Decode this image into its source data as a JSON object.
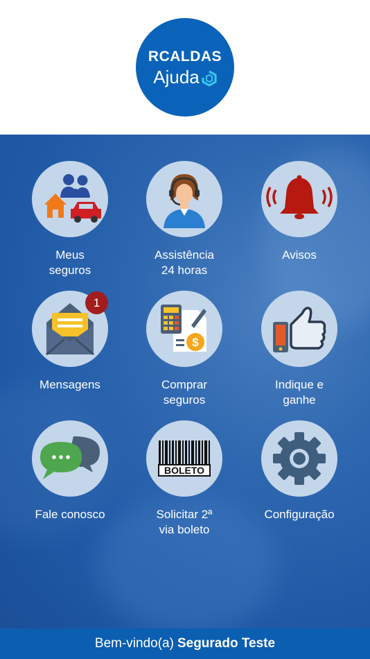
{
  "logo": {
    "brand": "RCALDAS",
    "sub": "Ajuda"
  },
  "menu": [
    {
      "id": "meus-seguros",
      "line1": "Meus",
      "line2": "seguros",
      "icon": "family-home-car-icon"
    },
    {
      "id": "assistencia",
      "line1": "Assistência",
      "line2": "24 horas",
      "icon": "call-center-agent-icon"
    },
    {
      "id": "avisos",
      "line1": "Avisos",
      "line2": "",
      "icon": "alarm-bell-icon"
    },
    {
      "id": "mensagens",
      "line1": "Mensagens",
      "line2": "",
      "icon": "envelope-open-icon",
      "badge": "1"
    },
    {
      "id": "comprar-seguros",
      "line1": "Comprar",
      "line2": "seguros",
      "icon": "calculator-document-icon"
    },
    {
      "id": "indique-e-ganhe",
      "line1": "Indique e",
      "line2": "ganhe",
      "icon": "thumbs-up-icon"
    },
    {
      "id": "fale-conosco",
      "line1": "Fale conosco",
      "line2": "",
      "icon": "chat-bubbles-icon"
    },
    {
      "id": "solicitar-boleto",
      "line1": "Solicitar 2ª",
      "line2": "via boleto",
      "icon": "barcode-boleto-icon",
      "icon_text": "BOLETO"
    },
    {
      "id": "configuracao",
      "line1": "Configuração",
      "line2": "",
      "icon": "gear-icon"
    }
  ],
  "footer": {
    "greeting": "Bem-vindo(a)",
    "user_name": "Segurado Teste"
  },
  "colors": {
    "brand_blue": "#0a63b9",
    "footer_blue": "#0b5eb0",
    "icon_circle": "#c4d6ea",
    "badge_red": "#a21d1d"
  }
}
